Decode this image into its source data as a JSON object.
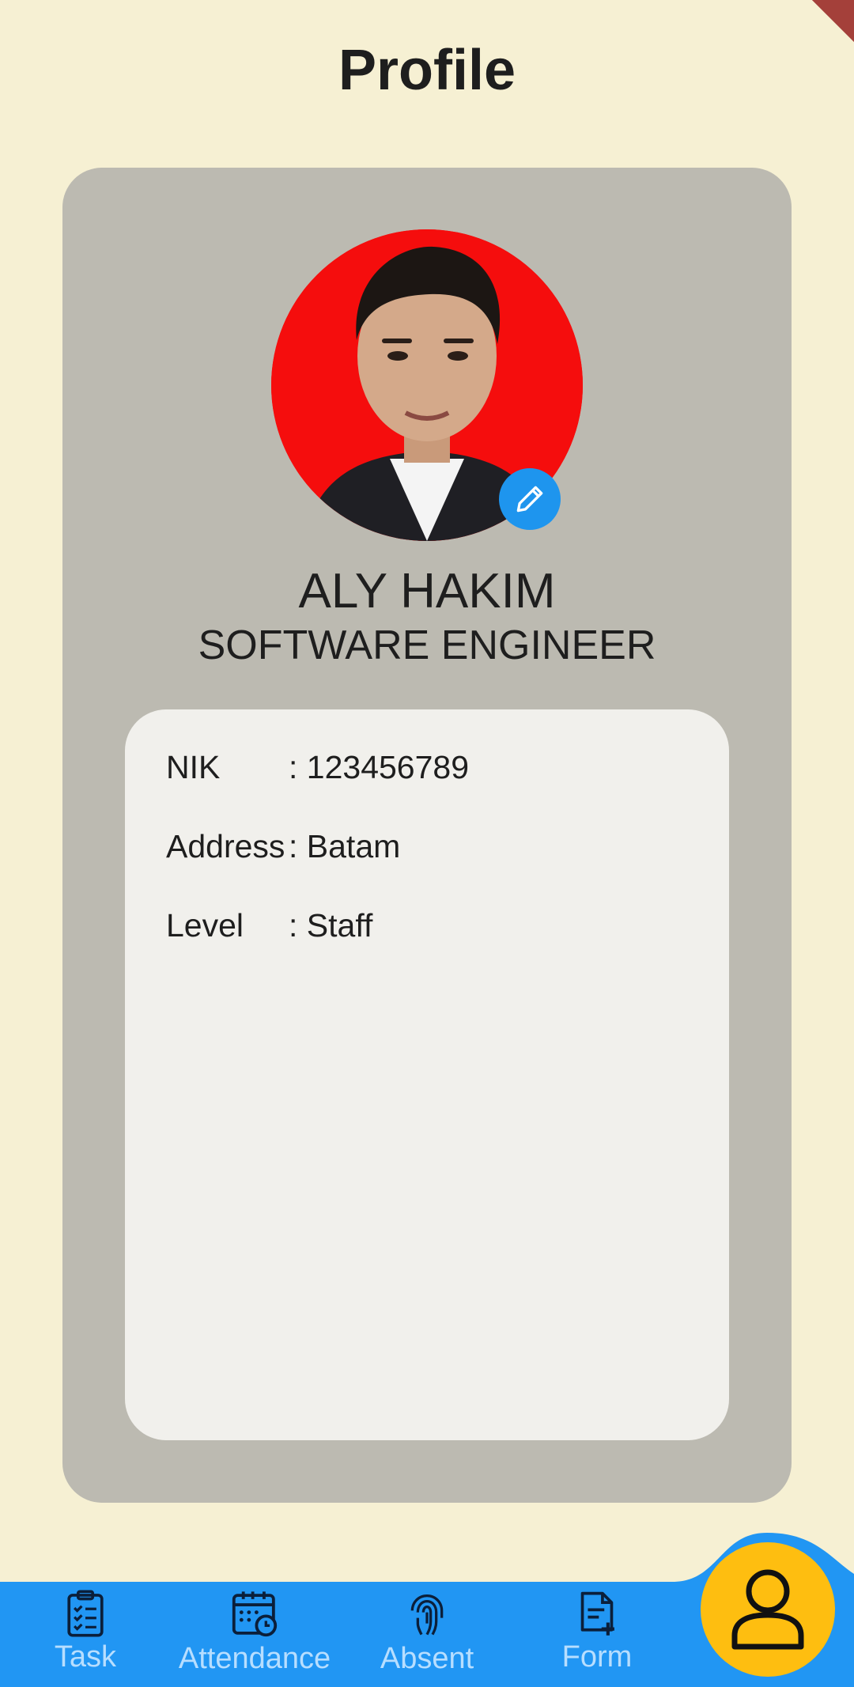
{
  "header": {
    "title": "Profile"
  },
  "profile": {
    "name": "ALY HAKIM",
    "role": "SOFTWARE ENGINEER",
    "details": [
      {
        "label": "NIK",
        "value": ": 123456789"
      },
      {
        "label": "Address",
        "value": ": Batam"
      },
      {
        "label": "Level",
        "value": ": Staff"
      }
    ]
  },
  "nav": {
    "items": [
      {
        "label": "Task",
        "icon": "clipboard-check-icon"
      },
      {
        "label": "Attendance",
        "icon": "calendar-clock-icon"
      },
      {
        "label": "Absent",
        "icon": "fingerprint-icon"
      },
      {
        "label": "Form",
        "icon": "document-add-icon"
      }
    ],
    "active": {
      "icon": "person-icon"
    }
  },
  "colors": {
    "background": "#F6F0D3",
    "card": "#BCBAB1",
    "panel": "#F1F0EC",
    "nav": "#2196F3",
    "fab": "#FEBE10",
    "edit": "#1E95EE",
    "avatar_bg": "#F50D0D"
  }
}
